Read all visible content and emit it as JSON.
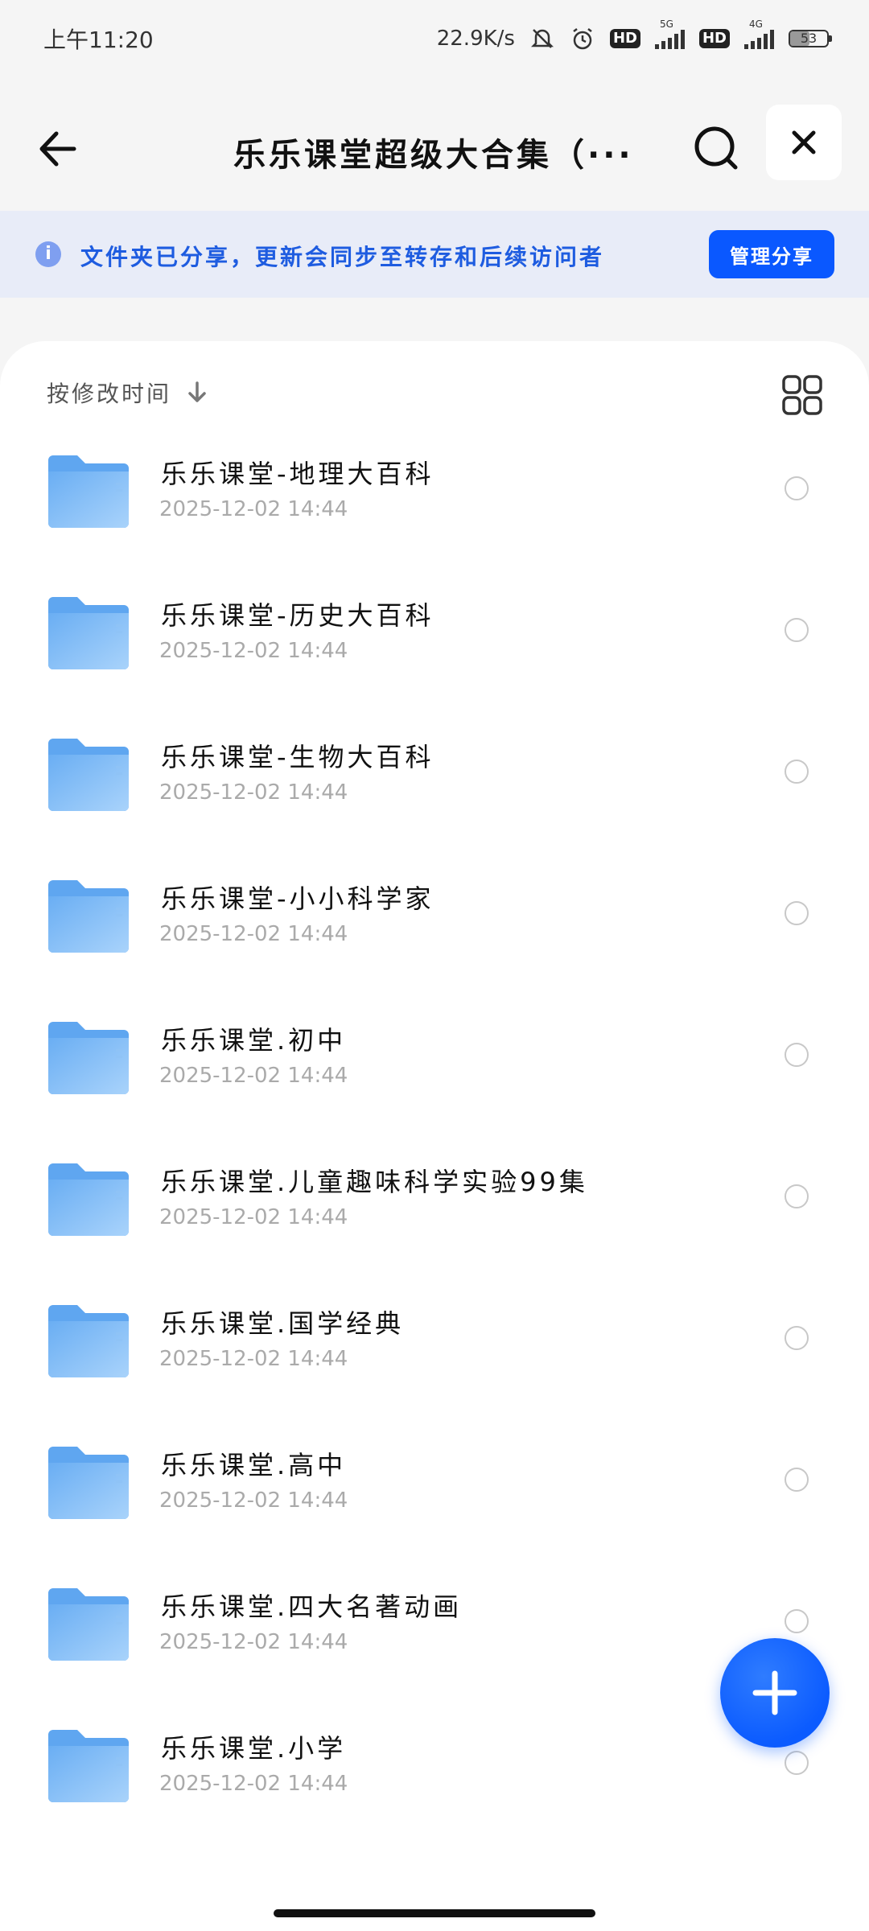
{
  "status_bar": {
    "time": "上午11:20",
    "net_speed": "22.9K/s",
    "hd1": "HD",
    "hd2": "HD",
    "sig1_tag": "5G",
    "sig2_tag": "4G",
    "battery": "53"
  },
  "header": {
    "title": "乐乐课堂超级大合集（···"
  },
  "banner": {
    "text": "文件夹已分享，更新会同步至转存和后续访问者",
    "manage_button": "管理分享"
  },
  "sort": {
    "label": "按修改时间"
  },
  "files": [
    {
      "name": "乐乐课堂-地理大百科",
      "date": "2025-12-02  14:44"
    },
    {
      "name": "乐乐课堂-历史大百科",
      "date": "2025-12-02  14:44"
    },
    {
      "name": "乐乐课堂-生物大百科",
      "date": "2025-12-02  14:44"
    },
    {
      "name": "乐乐课堂-小小科学家",
      "date": "2025-12-02  14:44"
    },
    {
      "name": "乐乐课堂.初中",
      "date": "2025-12-02  14:44"
    },
    {
      "name": "乐乐课堂.儿童趣味科学实验99集",
      "date": "2025-12-02  14:44"
    },
    {
      "name": "乐乐课堂.国学经典",
      "date": "2025-12-02  14:44"
    },
    {
      "name": "乐乐课堂.高中",
      "date": "2025-12-02  14:44"
    },
    {
      "name": "乐乐课堂.四大名著动画",
      "date": "2025-12-02  14:44"
    },
    {
      "name": "乐乐课堂.小学",
      "date": "2025-12-02  14:44"
    }
  ],
  "colors": {
    "accent": "#0a58ff",
    "banner_bg": "#e8ecf8",
    "banner_text": "#1e5ce0",
    "folder": "#7fb8f5"
  }
}
